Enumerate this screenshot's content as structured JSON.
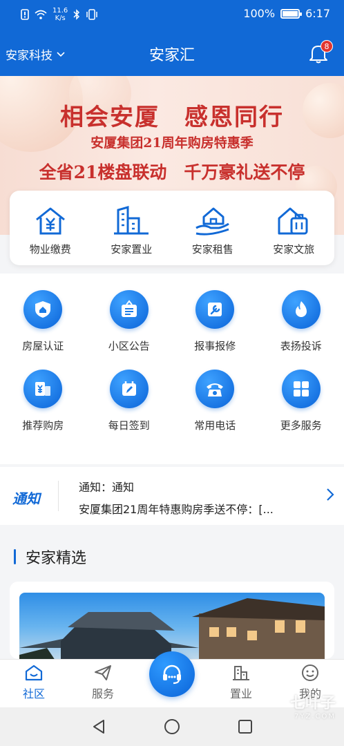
{
  "status": {
    "network_speed": "11.6",
    "network_unit": "K/s",
    "battery": "100%",
    "time": "6:17",
    "battery_level": 1.0
  },
  "header": {
    "org_selector": "安家科技",
    "title": "安家汇",
    "notification_count": "8"
  },
  "banner": {
    "line1": "相会安厦　感恩同行",
    "line2": "安厦集团21周年购房特惠季",
    "line3": "全省21楼盘联动　千万豪礼送不停"
  },
  "quick": [
    {
      "label": "物业缴费",
      "icon": "house-yen-icon"
    },
    {
      "label": "安家置业",
      "icon": "buildings-icon"
    },
    {
      "label": "安家租售",
      "icon": "hand-house-icon"
    },
    {
      "label": "安家文旅",
      "icon": "suitcase-house-icon"
    }
  ],
  "services": [
    {
      "label": "房屋认证",
      "icon": "shield-house-icon"
    },
    {
      "label": "小区公告",
      "icon": "notice-board-icon"
    },
    {
      "label": "报事报修",
      "icon": "wrench-icon"
    },
    {
      "label": "表扬投诉",
      "icon": "flame-icon"
    },
    {
      "label": "推荐购房",
      "icon": "building-yen-icon"
    },
    {
      "label": "每日签到",
      "icon": "calendar-pen-icon"
    },
    {
      "label": "常用电话",
      "icon": "telephone-icon"
    },
    {
      "label": "更多服务",
      "icon": "grid-icon"
    }
  ],
  "notice": {
    "logo": "通知",
    "title": "通知：通知",
    "body": "安厦集团21周年特惠购房季送不停：[..."
  },
  "section": {
    "title": "安家精选"
  },
  "bottom_nav": {
    "tabs": [
      {
        "label": "社区"
      },
      {
        "label": "服务"
      },
      {
        "label": "置业"
      },
      {
        "label": "我的"
      }
    ]
  },
  "watermark": {
    "text": "七叶子",
    "sub": "7YZ.COM"
  },
  "colors": {
    "primary": "#1169d6",
    "banner_text": "#c8302d",
    "badge": "#e2362f"
  }
}
